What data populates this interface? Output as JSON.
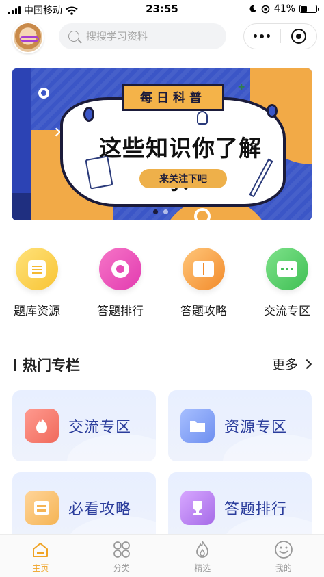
{
  "status_bar": {
    "carrier": "中国移动",
    "time": "23:55",
    "battery_percent": "41%",
    "battery_level": 0.41
  },
  "header": {
    "search_placeholder": "搜搜学习资料"
  },
  "banner": {
    "ribbon_text": "每日科普",
    "headline": "这些知识你了解吗？",
    "cta": "来关注下吧"
  },
  "quick_entries": [
    {
      "label": "题库资源",
      "icon": "clipboard-icon",
      "color": "#f8c435"
    },
    {
      "label": "答题排行",
      "icon": "medal-icon",
      "color": "#e23bb0"
    },
    {
      "label": "答题攻略",
      "icon": "book-icon",
      "color": "#f28b2b"
    },
    {
      "label": "交流专区",
      "icon": "chat-icon",
      "color": "#3fbf54"
    }
  ],
  "section": {
    "title": "热门专栏",
    "more": "更多"
  },
  "cards": [
    {
      "label": "交流专区",
      "icon": "fire-icon"
    },
    {
      "label": "资源专区",
      "icon": "folder-icon"
    },
    {
      "label": "必看攻略",
      "icon": "news-icon"
    },
    {
      "label": "答题排行",
      "icon": "trophy-icon"
    }
  ],
  "tabbar": {
    "items": [
      {
        "label": "主页",
        "icon": "home-icon",
        "active": true
      },
      {
        "label": "分类",
        "icon": "category-icon",
        "active": false
      },
      {
        "label": "精选",
        "icon": "flame-icon",
        "active": false
      },
      {
        "label": "我的",
        "icon": "smile-icon",
        "active": false
      }
    ],
    "active_color": "#f0a324"
  }
}
